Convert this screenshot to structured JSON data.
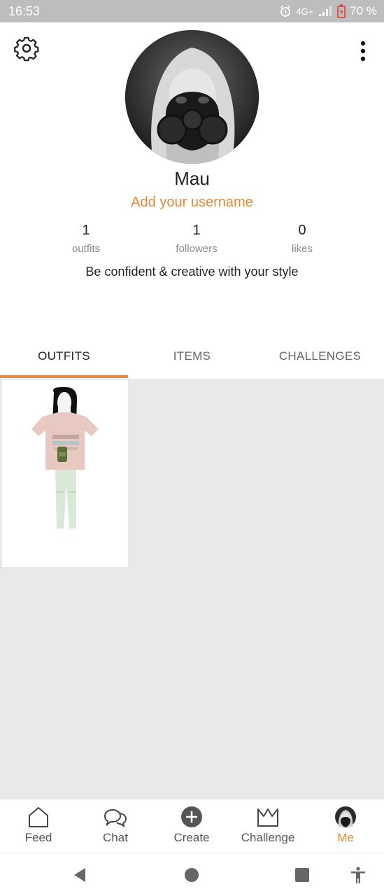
{
  "status_bar": {
    "time": "16:53",
    "network": "4G+",
    "battery": "70 %",
    "icons": [
      "alarm-icon",
      "signal-icon",
      "battery-icon"
    ]
  },
  "header": {
    "settings_icon": "gear-icon",
    "more_icon": "more-vertical-icon"
  },
  "profile": {
    "display_name": "Mau",
    "username_prompt": "Add your username",
    "bio": "Be confident & creative with your style",
    "stats": [
      {
        "value": "1",
        "label": "outfits"
      },
      {
        "value": "1",
        "label": "followers"
      },
      {
        "value": "0",
        "label": "likes"
      }
    ]
  },
  "tabs": [
    {
      "label": "OUTFITS",
      "active": true
    },
    {
      "label": "ITEMS",
      "active": false
    },
    {
      "label": "CHALLENGES",
      "active": false
    }
  ],
  "bottom_nav": [
    {
      "label": "Feed",
      "icon": "home-icon",
      "active": false
    },
    {
      "label": "Chat",
      "icon": "chat-icon",
      "active": false
    },
    {
      "label": "Create",
      "icon": "plus-circle-icon",
      "active": false
    },
    {
      "label": "Challenge",
      "icon": "crown-icon",
      "active": false
    },
    {
      "label": "Me",
      "icon": "avatar-icon",
      "active": true
    }
  ],
  "colors": {
    "accent": "#e8893d",
    "status_bar": "#bdbdbd",
    "grid_background": "#e9e9e9",
    "battery_low": "#e53935"
  }
}
